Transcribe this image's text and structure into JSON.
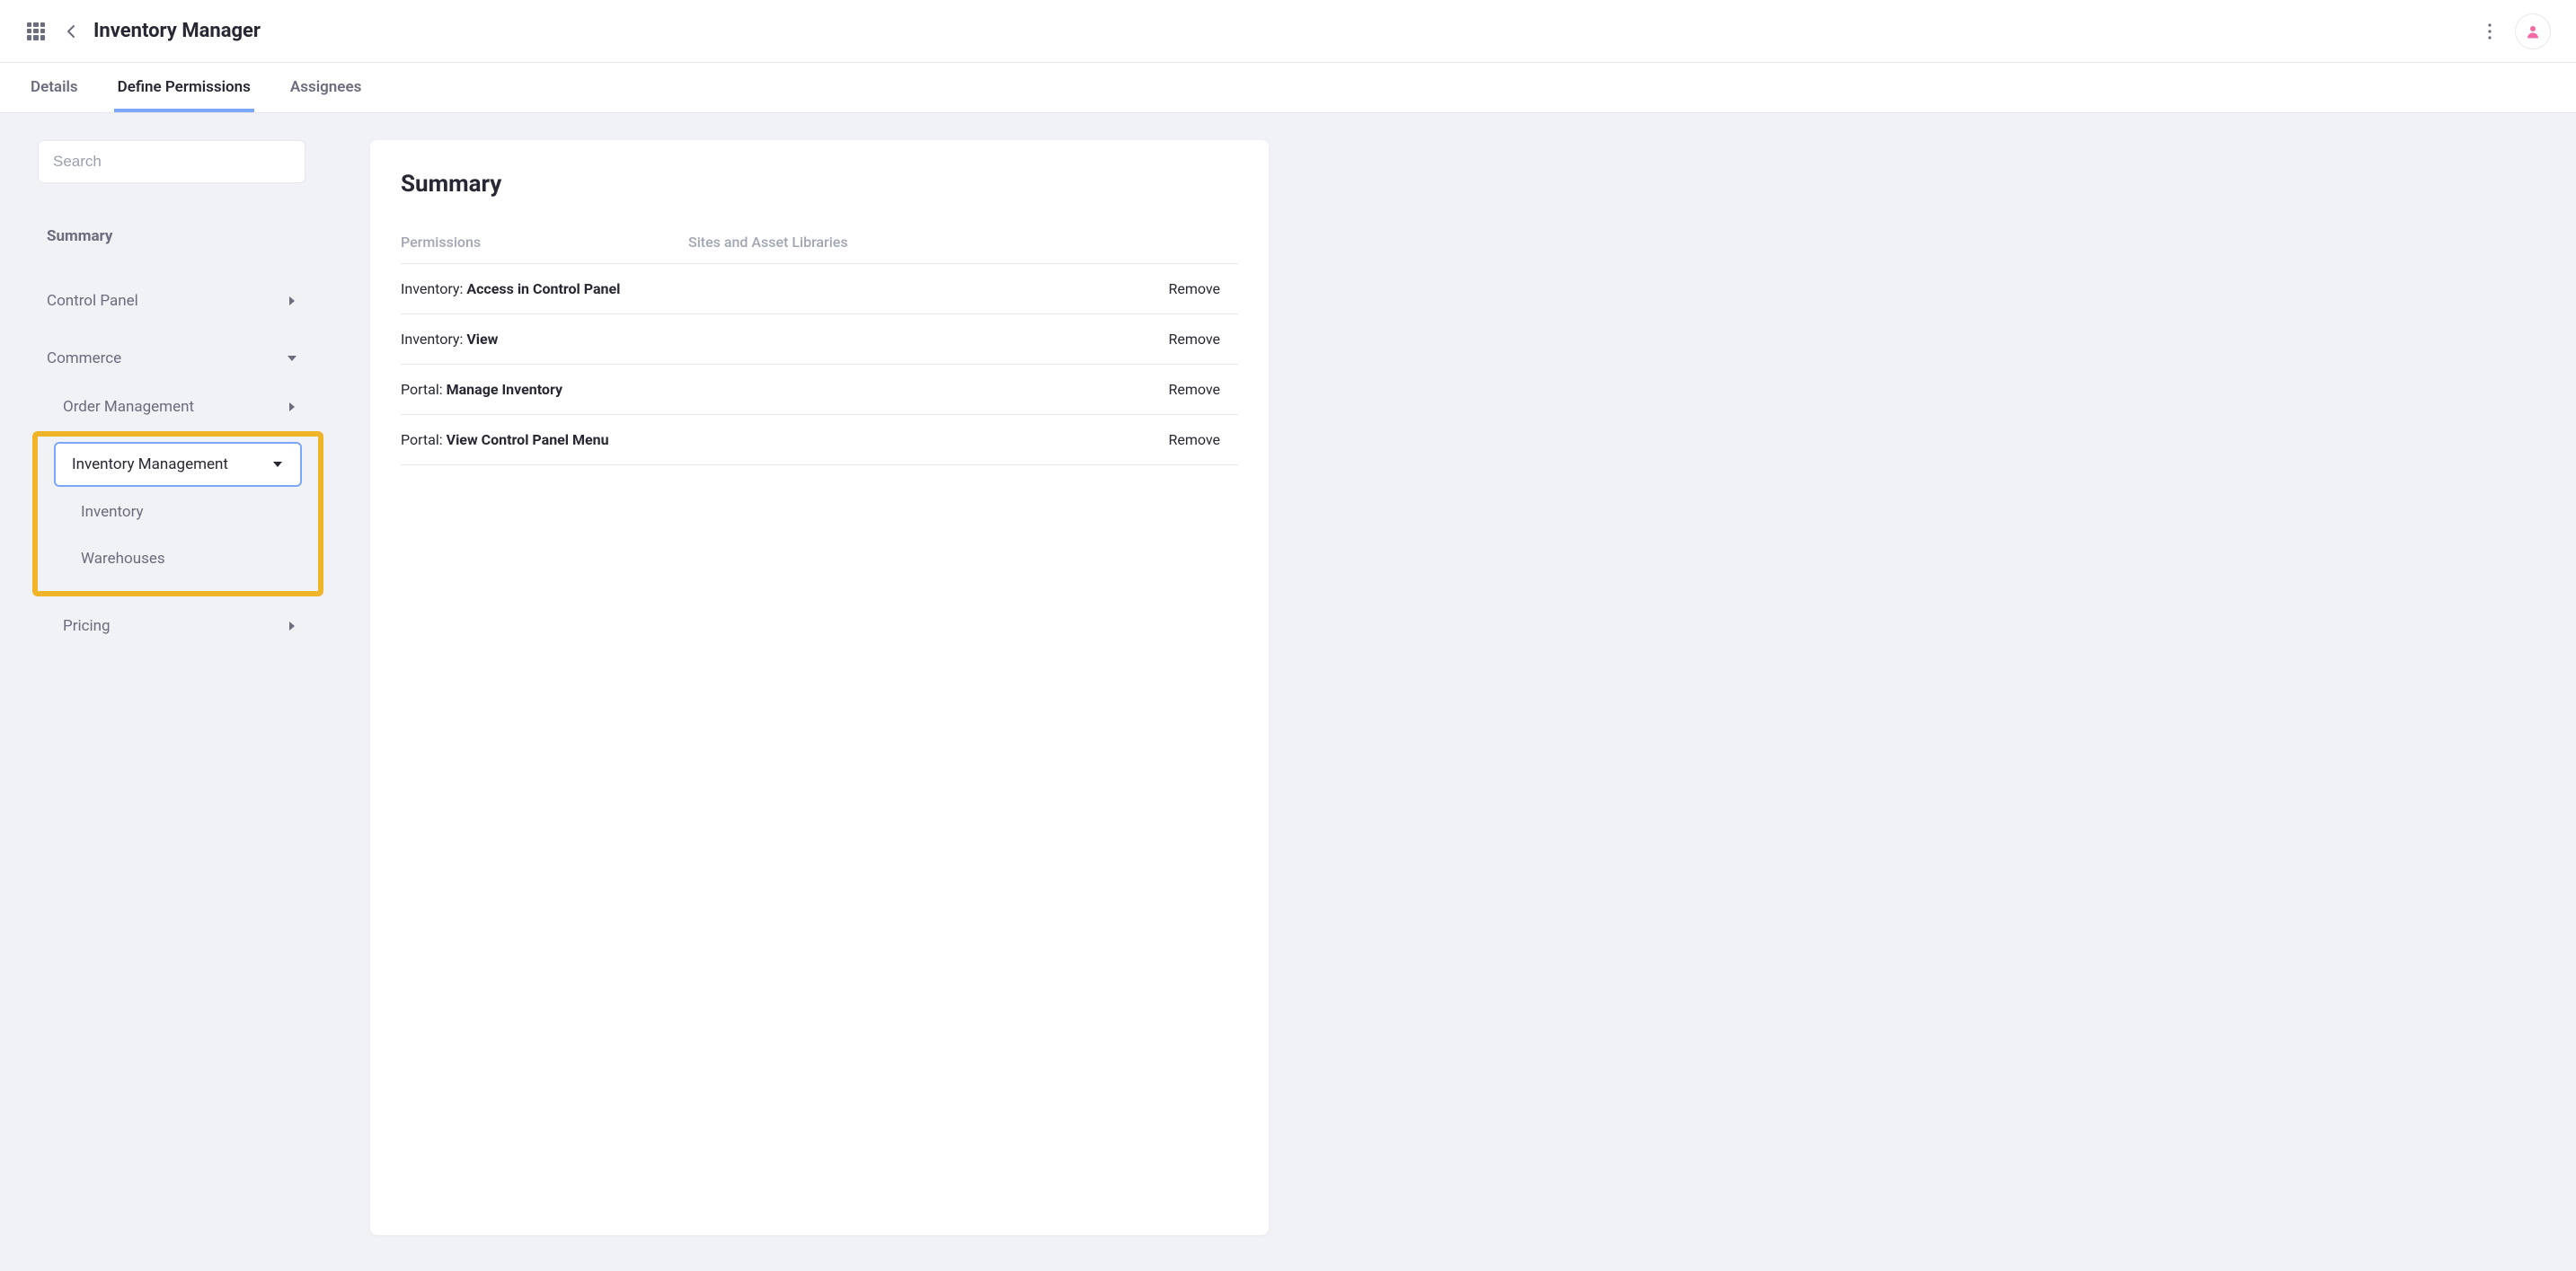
{
  "header": {
    "title": "Inventory Manager"
  },
  "tabs": [
    {
      "label": "Details",
      "active": false
    },
    {
      "label": "Define Permissions",
      "active": true
    },
    {
      "label": "Assignees",
      "active": false
    }
  ],
  "sidebar": {
    "search_placeholder": "Search",
    "summary_label": "Summary",
    "items": {
      "control_panel": "Control Panel",
      "commerce": "Commerce",
      "order_management": "Order Management",
      "inventory_management": "Inventory Management",
      "inventory": "Inventory",
      "warehouses": "Warehouses",
      "pricing": "Pricing"
    }
  },
  "main": {
    "heading": "Summary",
    "columns": {
      "permissions": "Permissions",
      "sites": "Sites and Asset Libraries"
    },
    "rows": [
      {
        "scope": "Inventory:",
        "action": "Access in Control Panel"
      },
      {
        "scope": "Inventory:",
        "action": "View"
      },
      {
        "scope": "Portal:",
        "action": "Manage Inventory"
      },
      {
        "scope": "Portal:",
        "action": "View Control Panel Menu"
      }
    ],
    "remove_label": "Remove"
  }
}
